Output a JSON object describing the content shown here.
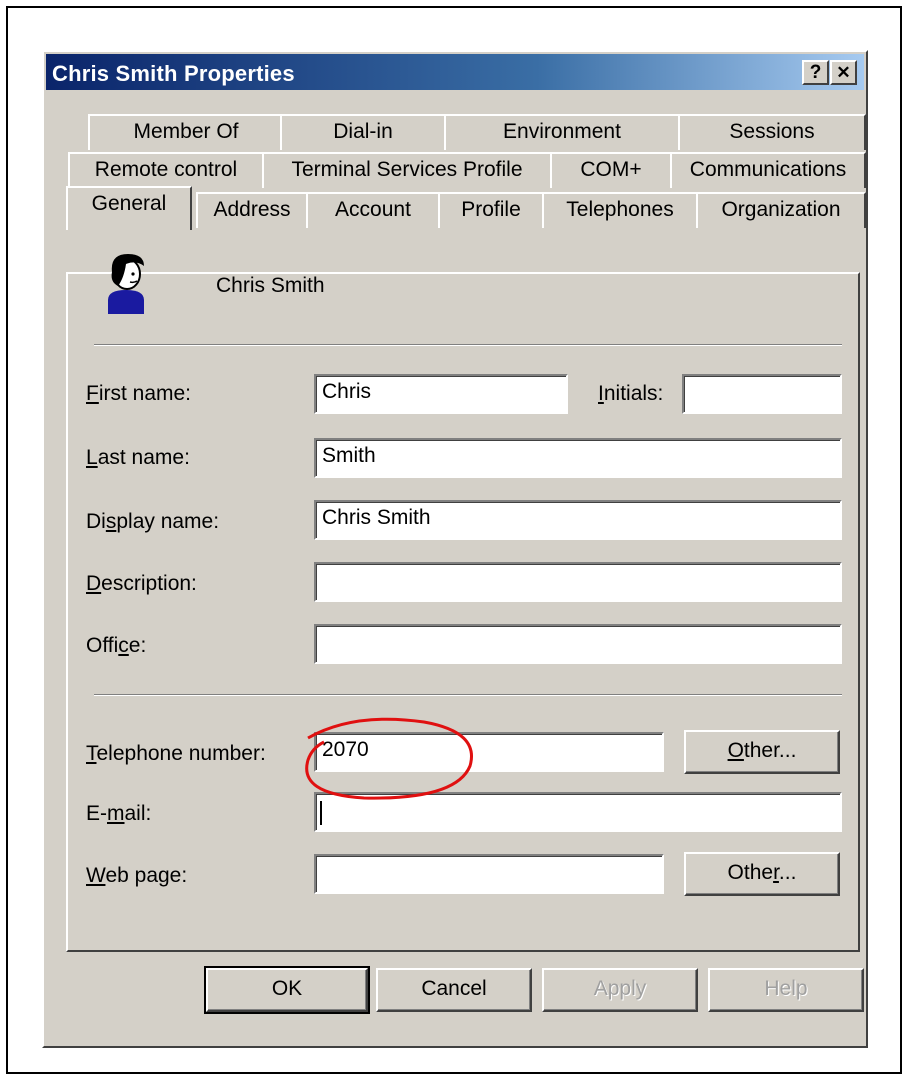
{
  "window": {
    "title": "Chris Smith Properties",
    "help_button": "?",
    "close_button": "✕"
  },
  "tabs": {
    "row1": [
      "Member Of",
      "Dial-in",
      "Environment",
      "Sessions"
    ],
    "row2": [
      "Remote control",
      "Terminal Services Profile",
      "COM+",
      "Communications"
    ],
    "row3": [
      "General",
      "Address",
      "Account",
      "Profile",
      "Telephones",
      "Organization"
    ],
    "active": "General"
  },
  "user": {
    "display": "Chris Smith",
    "icon": "user-icon"
  },
  "fields": {
    "first_name": {
      "label_u": "F",
      "label_rest": "irst name:",
      "value": "Chris"
    },
    "initials": {
      "label_u": "I",
      "label_rest": "nitials:",
      "value": ""
    },
    "last_name": {
      "label_u": "L",
      "label_rest": "ast name:",
      "value": "Smith"
    },
    "display_name": {
      "label_pre": "Di",
      "label_u": "s",
      "label_rest": "play name:",
      "value": "Chris Smith"
    },
    "description": {
      "label_u": "D",
      "label_rest": "escription:",
      "value": ""
    },
    "office": {
      "label_pre": "Offi",
      "label_u": "c",
      "label_rest": "e:",
      "value": ""
    },
    "telephone": {
      "label_u": "T",
      "label_rest": "elephone number:",
      "value": "2070"
    },
    "email": {
      "label_pre": "E-",
      "label_u": "m",
      "label_rest": "ail:",
      "value": ""
    },
    "web_page": {
      "label_u": "W",
      "label_rest": "eb page:",
      "value": ""
    }
  },
  "buttons": {
    "tel_other": {
      "label_u": "O",
      "label_rest": "ther..."
    },
    "web_other": {
      "label_pre": "Othe",
      "label_u": "r",
      "label_rest": "..."
    },
    "ok": "OK",
    "cancel": "Cancel",
    "apply": "Apply",
    "help": "Help"
  },
  "colors": {
    "title_start": "#0a246a",
    "title_end": "#a6caf0",
    "dialog_bg": "#d4d0c8",
    "annotation": "#e01010"
  }
}
